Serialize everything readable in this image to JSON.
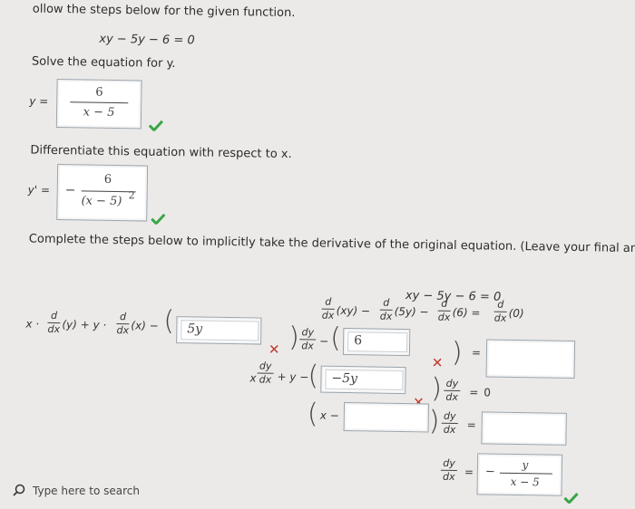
{
  "header": {
    "instruction": "ollow the steps below for the given function."
  },
  "equation": "xy − 5y − 6 = 0",
  "step1": {
    "label": "Solve the equation for y.",
    "lhs": "y =",
    "num": "6",
    "den": "x − 5"
  },
  "step2": {
    "label": "Differentiate this equation with respect to x.",
    "lhs": "y' =",
    "sign": "−",
    "num": "6",
    "den": "(x − 5)",
    "exp": "2"
  },
  "step3": {
    "label": "Complete the steps below to implicitly take the derivative of the original equation. (Leave your final answer"
  },
  "implicit": {
    "line0": "xy − 5y − 6 = 0",
    "d": "d",
    "dx": "dx",
    "dy": "dy",
    "t_xy": "(xy) −",
    "t_5y": "(5y) −",
    "t_6": "(6) =",
    "t_0": "(0)",
    "x_dot": "x ·",
    "t_y": "(y) + y ·",
    "t_x": "(x) −",
    "input_5y": "5y",
    "input_6": "6",
    "input_neg5y": "−5y",
    "x_pre": "x",
    "plus_y": "+ y −",
    "eq": "=",
    "zero": "0",
    "xminus": "x −",
    "final_y": "y",
    "final_den": "x − 5",
    "final_sign": "−"
  },
  "taskbar": {
    "search_placeholder": "Type here to search"
  },
  "colors": {
    "check": "#3aa547",
    "wrong": "#c0392b"
  }
}
